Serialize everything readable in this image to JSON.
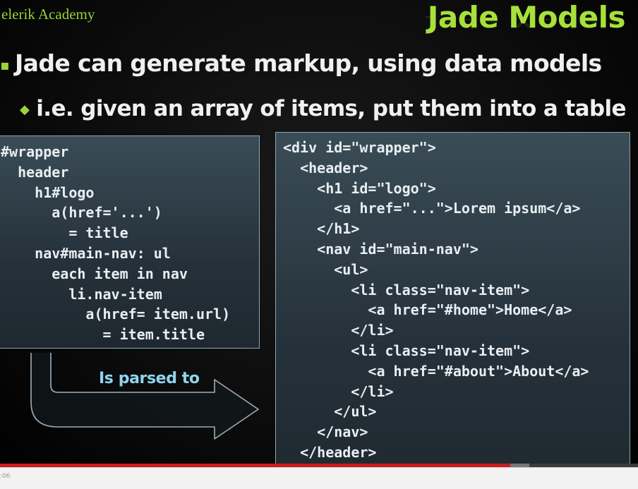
{
  "slide": {
    "brand": "elerik Academy",
    "title": "Jade Models",
    "bullet1": "Jade can generate markup, using data models",
    "bullet2": "i.e. given an array of items, put them into a table",
    "jade_code": "#wrapper\n  header\n    h1#logo\n      a(href='...')\n        = title\n    nav#main-nav: ul\n      each item in nav\n        li.nav-item\n          a(href= item.url)\n            = item.title",
    "html_code": "<div id=\"wrapper\">\n  <header>\n    <h1 id=\"logo\">\n      <a href=\"...\">Lorem ipsum</a>\n    </h1>\n    <nav id=\"main-nav\">\n      <ul>\n        <li class=\"nav-item\">\n          <a href=\"#home\">Home</a>\n        </li>\n        <li class=\"nav-item\">\n          <a href=\"#about\">About</a>\n        </li>\n      </ul>\n    </nav>\n  </header>\n</div>",
    "arrow_label": "Is parsed to"
  },
  "player": {
    "time": ":06",
    "progress_fraction": 0.8,
    "buffer_fraction": 0.83
  },
  "colors": {
    "accent": "#a8e03a",
    "arrow_label": "#8fd4ef",
    "code_text": "#e8eef2",
    "progress": "#cc1b1b"
  }
}
